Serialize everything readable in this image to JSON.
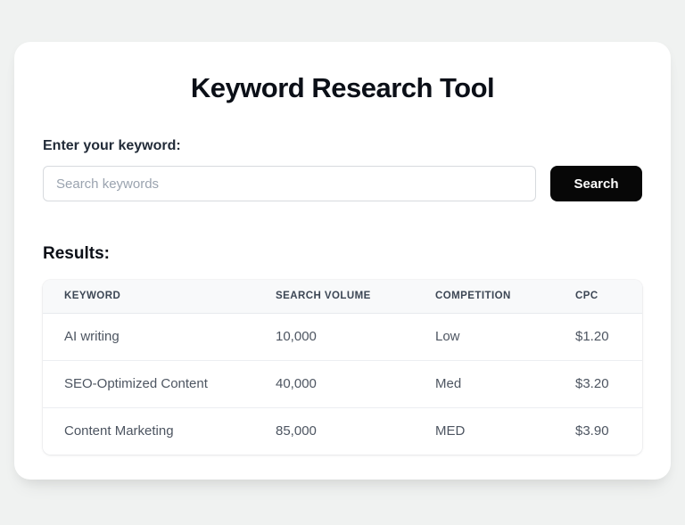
{
  "page": {
    "background_color": "#f0f2f1",
    "card_color": "#ffffff",
    "title": "Keyword Research Tool"
  },
  "search": {
    "label": "Enter your keyword:",
    "input_value": "",
    "input_placeholder": "Search keywords",
    "button_label": "Search",
    "button_color": "#070707",
    "button_text_color": "#ffffff"
  },
  "results": {
    "heading": "Results:",
    "table": {
      "columns": [
        "KEYWORD",
        "SEARCH VOLUME",
        "COMPETITION",
        "CPC"
      ],
      "rows": [
        {
          "keyword": "AI writing",
          "search_volume": "10,000",
          "competition": "Low",
          "cpc": "$1.20"
        },
        {
          "keyword": "SEO-Optimized Content",
          "search_volume": "40,000",
          "competition": "Med",
          "cpc": "$3.20"
        },
        {
          "keyword": "Content Marketing",
          "search_volume": "85,000",
          "competition": "MED",
          "cpc": "$3.90"
        }
      ],
      "header_background": "#f8f9fa"
    }
  }
}
